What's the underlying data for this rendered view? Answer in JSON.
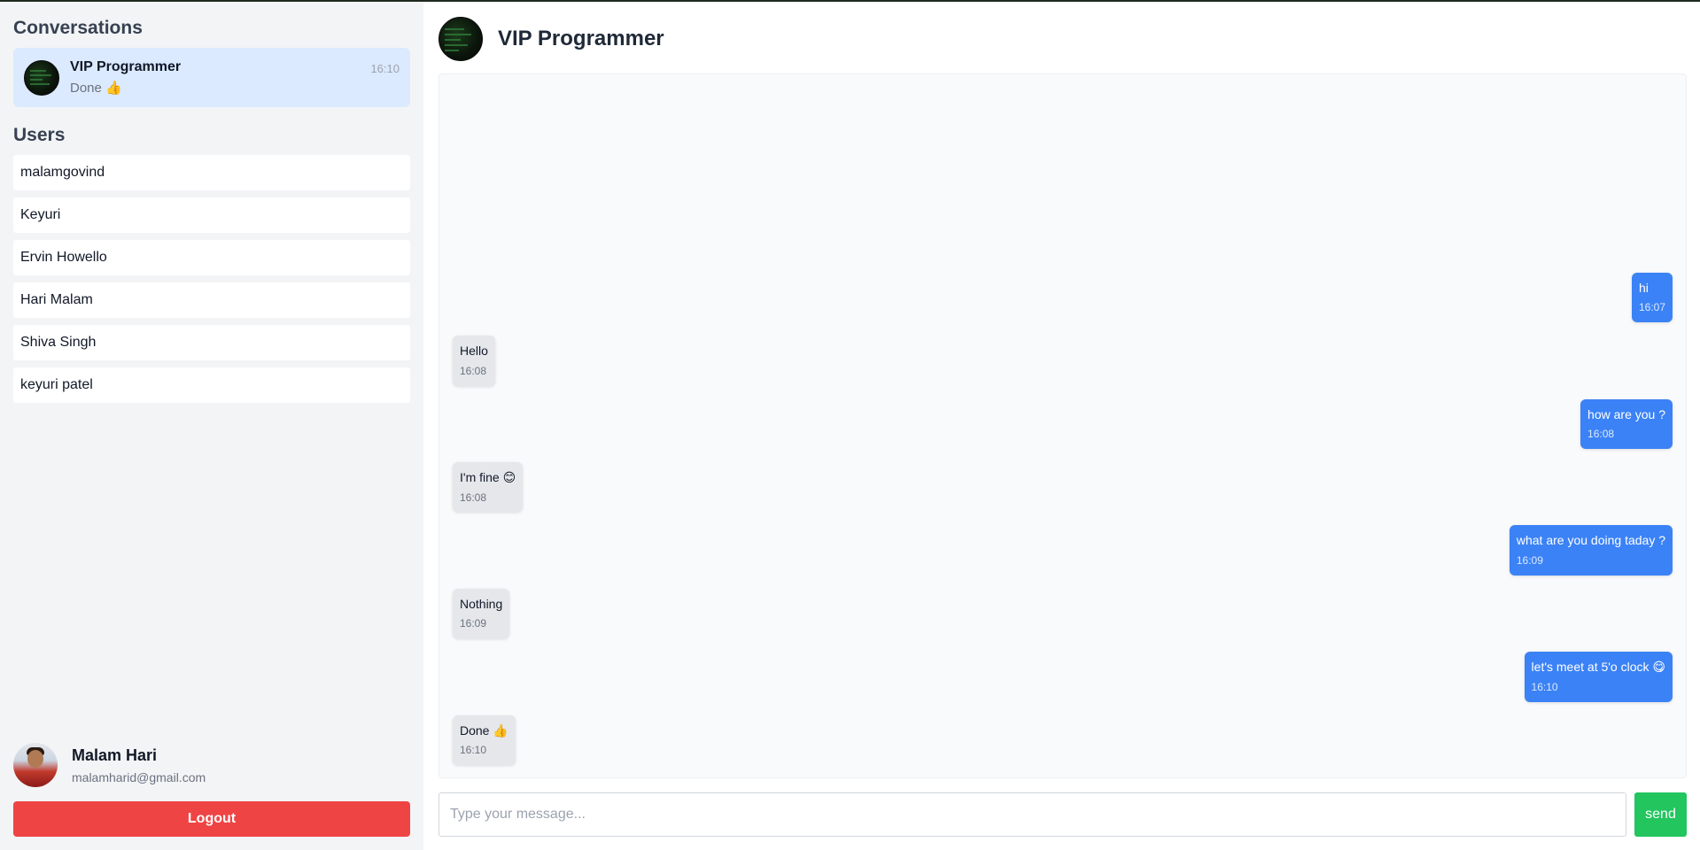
{
  "sidebar": {
    "conversations_title": "Conversations",
    "conversations": [
      {
        "name": "VIP Programmer",
        "last_message": "Done 👍",
        "time": "16:10"
      }
    ],
    "users_title": "Users",
    "users": [
      "malamgovind",
      "Keyuri",
      "Ervin Howello",
      "Hari Malam",
      "Shiva Singh",
      "keyuri patel"
    ],
    "profile": {
      "name": "Malam Hari",
      "email": "malamharid@gmail.com"
    },
    "logout_label": "Logout"
  },
  "chat": {
    "title": "VIP Programmer",
    "messages": [
      {
        "text": "hi",
        "time": "16:07",
        "direction": "sent"
      },
      {
        "text": "Hello",
        "time": "16:08",
        "direction": "received"
      },
      {
        "text": "how are you ?",
        "time": "16:08",
        "direction": "sent"
      },
      {
        "text": "I'm fine 😊",
        "time": "16:08",
        "direction": "received"
      },
      {
        "text": "what are you doing taday ?",
        "time": "16:09",
        "direction": "sent"
      },
      {
        "text": "Nothing",
        "time": "16:09",
        "direction": "received"
      },
      {
        "text": "let's meet at 5'o clock 😋",
        "time": "16:10",
        "direction": "sent"
      },
      {
        "text": "Done 👍",
        "time": "16:10",
        "direction": "received"
      }
    ],
    "input_placeholder": "Type your message...",
    "input_value": "",
    "send_label": "send"
  },
  "colors": {
    "sent_bubble": "#3b82f6",
    "received_bubble": "#e5e7eb",
    "active_conversation": "#dbeafe",
    "logout": "#ef4444",
    "send": "#22c55e"
  },
  "icons": {
    "conversation_avatar": "code-screen-avatar",
    "profile_avatar": "user-photo-avatar"
  }
}
